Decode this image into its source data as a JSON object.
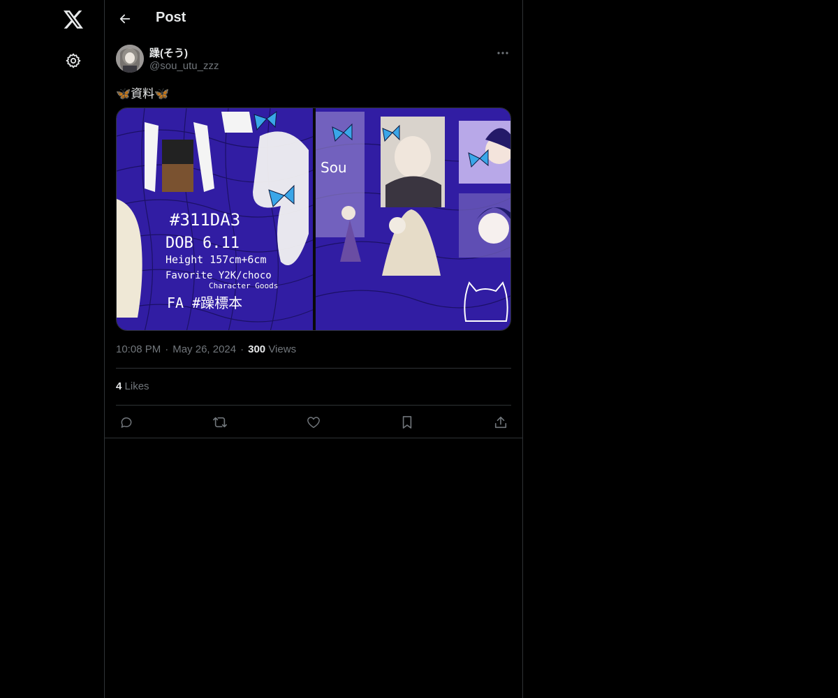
{
  "header": {
    "title": "Post"
  },
  "post": {
    "author": {
      "display_name": "躁(そう)",
      "handle": "@sou_utu_zzz"
    },
    "text": "🦋資料🦋",
    "image_text": {
      "hex": "#311DA3",
      "dob": "DOB 6.11",
      "height": "Height 157cm+6cm",
      "favorite": "Favorite Y2K/choco",
      "goods": "Character Goods",
      "fa": "FA #躁標本",
      "sou": "Sou"
    },
    "time": "10:08 PM",
    "date": "May 26, 2024",
    "views_count": "300",
    "views_label": "Views",
    "likes_count": "4",
    "likes_label": "Likes",
    "separator": "·"
  },
  "colors": {
    "background": "#000000",
    "text": "#e7e9ea",
    "muted": "#71767b",
    "border": "#2f3336",
    "art_blue": "#311DA3"
  },
  "icons": {
    "logo": "x-logo-icon",
    "settings": "gear-icon",
    "back": "arrow-left-icon",
    "more": "more-horizontal-icon",
    "reply": "reply-icon",
    "repost": "repost-icon",
    "like": "heart-icon",
    "bookmark": "bookmark-icon",
    "share": "share-icon"
  }
}
